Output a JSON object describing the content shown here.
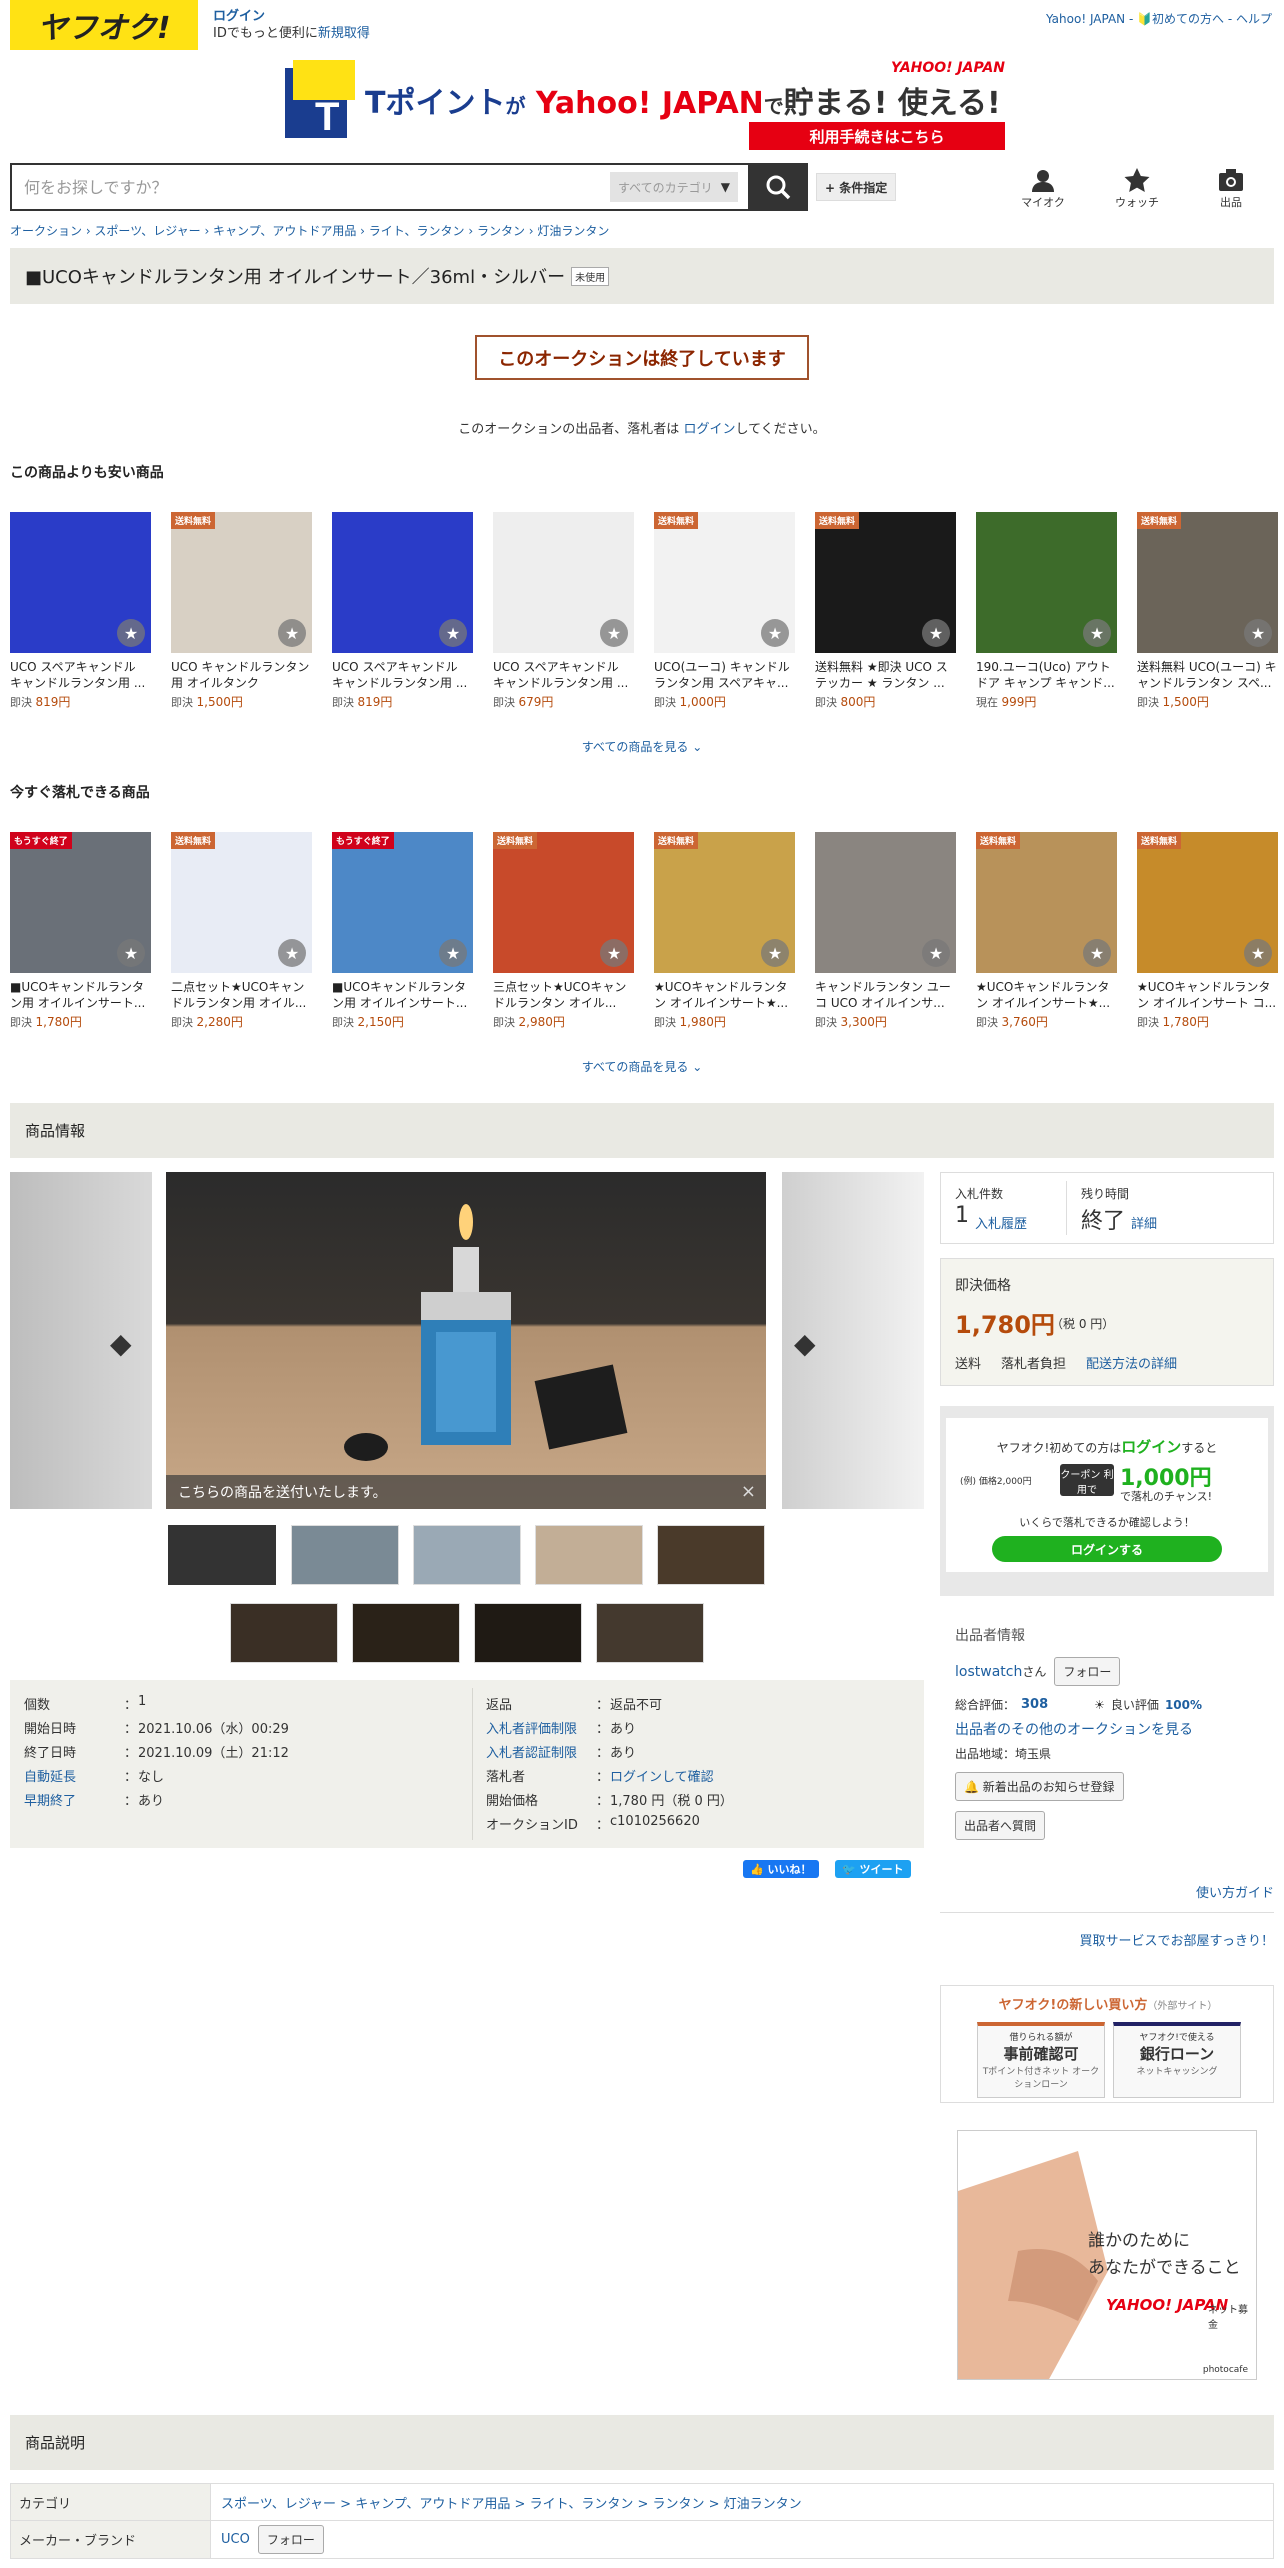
{
  "header": {
    "logo": "ヤフオク!",
    "login": "ログイン",
    "login_sub": "IDでもっと便利に",
    "signup": "新規取得",
    "right_links": "Yahoo! JAPAN - 🔰初めての方へ - ヘルプ"
  },
  "banner": {
    "brand": "Tポイント",
    "text1": "が",
    "text2": "Yahoo! JAPAN",
    "text3": "で",
    "text4": "貯まる! 使える!",
    "yahoo_logo": "YAHOO! JAPAN",
    "cta": "利用手続きはこちら"
  },
  "search": {
    "placeholder": "何をお探しですか？",
    "category": "すべてのカテゴリ",
    "conditions": "+ 条件指定"
  },
  "header_icons": [
    {
      "label": "マイオク",
      "icon": "person-icon"
    },
    {
      "label": "ウォッチ",
      "icon": "star-icon"
    },
    {
      "label": "出品",
      "icon": "camera-icon"
    }
  ],
  "breadcrumb": "オークション › スポーツ、レジャー › キャンプ、アウトドア用品 › ライト、ランタン › ランタン › 灯油ランタン",
  "title": {
    "text": "■UCOキャンドルランタン用 オイルインサート／36ml・シルバー",
    "tag": "未使用"
  },
  "ended": {
    "notice": "このオークションは終了しています",
    "note_pre": "このオークションの出品者、落札者は ",
    "note_link": "ログイン",
    "note_post": "してください。"
  },
  "cheaper": {
    "heading": "この商品よりも安い商品",
    "see_all": "すべての商品を見る",
    "items": [
      {
        "name": "UCO スペアキャンドル キャンドルランタン用 ...",
        "label": "即決",
        "price": "819円",
        "badge": ""
      },
      {
        "name": "UCO キャンドルランタン 用 オイルタンク",
        "label": "即決",
        "price": "1,500円",
        "badge": "送料無料"
      },
      {
        "name": "UCO スペアキャンドル キャンドルランタン用 ...",
        "label": "即決",
        "price": "819円",
        "badge": ""
      },
      {
        "name": "UCO スペアキャンドル キャンドルランタン用 ...",
        "label": "即決",
        "price": "679円",
        "badge": ""
      },
      {
        "name": "UCO(ユーコ) キャンドル ランタン用 スペアキャ...",
        "label": "即決",
        "price": "1,000円",
        "badge": "送料無料"
      },
      {
        "name": "送料無料 ★即決 UCO ス テッカー ★ ランタン ...",
        "label": "即決",
        "price": "800円",
        "badge": "送料無料"
      },
      {
        "name": "190.ユーコ(Uco) アウト ドア キャンプ キャンド...",
        "label": "現在",
        "price": "999円",
        "badge": ""
      },
      {
        "name": "送料無料 UCO(ユーコ) キ ャンドルランタン スペ...",
        "label": "即決",
        "price": "1,500円",
        "badge": "送料無料"
      }
    ]
  },
  "buynow": {
    "heading": "今すぐ落札できる商品",
    "see_all": "すべての商品を見る",
    "items": [
      {
        "name": "■UCOキャンドルランタ ン用 オイルインサート...",
        "label": "即決",
        "price": "1,780円",
        "badge": "もうすぐ終了"
      },
      {
        "name": "二点セット★UCOキャン ドルランタン用 オイル...",
        "label": "即決",
        "price": "2,280円",
        "badge": "送料無料"
      },
      {
        "name": "■UCOキャンドルランタ ン用 オイルインサート...",
        "label": "即決",
        "price": "2,150円",
        "badge": "もうすぐ終了"
      },
      {
        "name": "三点セット★UCOキャン ドルランタン オイル...",
        "label": "即決",
        "price": "2,980円",
        "badge": "送料無料"
      },
      {
        "name": "★UCOキャンドルランタ ン オイルインサート★...",
        "label": "即決",
        "price": "1,980円",
        "badge": "送料無料"
      },
      {
        "name": "キャンドルランタン ユー コ UCO オイルインサ...",
        "label": "即決",
        "price": "3,300円",
        "badge": ""
      },
      {
        "name": "★UCOキャンドルランタ ン オイルインサート★...",
        "label": "即決",
        "price": "3,760円",
        "badge": "送料無料"
      },
      {
        "name": "★UCOキャンドルランタ ン オイルインサート コ...",
        "label": "即決",
        "price": "1,780円",
        "badge": "送料無料"
      }
    ]
  },
  "item_info": {
    "heading": "商品情報",
    "caption": "こちらの商品を送付いたします。"
  },
  "details_left": [
    {
      "k": "個数",
      "v": "1",
      "link": false
    },
    {
      "k": "開始日時",
      "v": "2021.10.06（水）00:29",
      "link": false
    },
    {
      "k": "終了日時",
      "v": "2021.10.09（土）21:12",
      "link": false
    },
    {
      "k": "自動延長",
      "v": "なし",
      "link": true
    },
    {
      "k": "早期終了",
      "v": "あり",
      "link": true
    }
  ],
  "details_right": [
    {
      "k": "返品",
      "v": "返品不可",
      "link": false,
      "vlink": false
    },
    {
      "k": "入札者評価制限",
      "v": "あり",
      "link": true,
      "vlink": false
    },
    {
      "k": "入札者認証制限",
      "v": "あり",
      "link": true,
      "vlink": false
    },
    {
      "k": "落札者",
      "v": "ログインして確認",
      "link": false,
      "vlink": true
    },
    {
      "k": "開始価格",
      "v": "1,780 円（税 0 円）",
      "link": false,
      "vlink": false
    },
    {
      "k": "オークションID",
      "v": "c1010256620",
      "link": false,
      "vlink": false
    }
  ],
  "social": {
    "like": "いいね！",
    "tweet": "ツイート"
  },
  "bid": {
    "count_label": "入札件数",
    "count": "1",
    "history": "入札履歴",
    "time_label": "残り時間",
    "time": "終了",
    "detail": "詳細"
  },
  "price": {
    "label": "即決価格",
    "value": "1,780円",
    "tax": "（税 0 円）",
    "ship_label": "送料",
    "ship_value": "落札者負担",
    "ship_link": "配送方法の詳細"
  },
  "ad1": {
    "line1": "ヤフオク!初めての方は",
    "login": "ログイン",
    "line1b": "すると",
    "ex": "(例) 価格2,000円",
    "coupon": "クーポン 利用で",
    "amount": "1,000円",
    "tail": "で落札のチャンス!",
    "line3": "いくらで落札できるか確認しよう！",
    "button": "ログインする"
  },
  "seller": {
    "heading": "出品者情報",
    "name": "lostwatch",
    "san": "さん",
    "follow": "フォロー",
    "total_label": "総合評価：",
    "total": "308",
    "good_label": "良い評価",
    "good": "100%",
    "other": "出品者のその他のオークションを見る",
    "region": "出品地域：埼玉県",
    "notify": "新着出品のお知らせ登録",
    "ask": "出品者へ質問"
  },
  "guide": "使い方ガイド",
  "buyback": "買取サービスでお部屋すっきり！",
  "newbuy": {
    "title": "ヤフオク!の新しい買い方",
    "ext": "（外部サイト）",
    "b1a": "借りられる額が",
    "b1b": "事前確認可",
    "b1c": "Tポイント付きネット オークションローン",
    "b2a": "ヤフオク!で使える",
    "b2b": "銀行ローン",
    "b2c": "ネットキャッシング"
  },
  "ad2": {
    "line1": "誰かのために",
    "line2": "あなたができること",
    "logo": "YAHOO! JAPAN",
    "tag": "ネット募金",
    "credit": "photocafe"
  },
  "desc": {
    "heading": "商品説明",
    "rows": [
      {
        "k": "カテゴリ",
        "v": "スポーツ、レジャー > キャンプ、アウトドア用品 > ライト、ランタン > ランタン > 灯油ランタン"
      },
      {
        "k": "メーカー・ブランド",
        "v": "UCO",
        "follow": "フォロー"
      }
    ]
  },
  "colors": {
    "accent": "#1e5fa0",
    "price": "#b54b0c",
    "green": "#1fb11f",
    "logo_bg": "#ffe214"
  }
}
